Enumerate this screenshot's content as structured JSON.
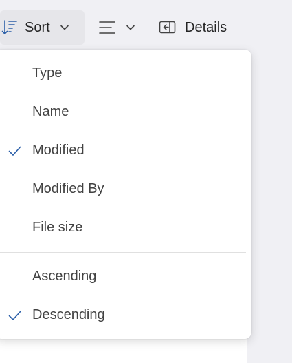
{
  "toolbar": {
    "sort_label": "Sort",
    "details_label": "Details"
  },
  "sort_menu": {
    "fields": [
      {
        "label": "Type",
        "checked": false
      },
      {
        "label": "Name",
        "checked": false
      },
      {
        "label": "Modified",
        "checked": true
      },
      {
        "label": "Modified By",
        "checked": false
      },
      {
        "label": "File size",
        "checked": false
      }
    ],
    "order": [
      {
        "label": "Ascending",
        "checked": false
      },
      {
        "label": "Descending",
        "checked": true
      }
    ]
  },
  "colors": {
    "accent": "#2b5fa8",
    "text": "#424242",
    "sort_button_bg": "#e6e6ea",
    "page_bg": "#f0f0f4"
  }
}
